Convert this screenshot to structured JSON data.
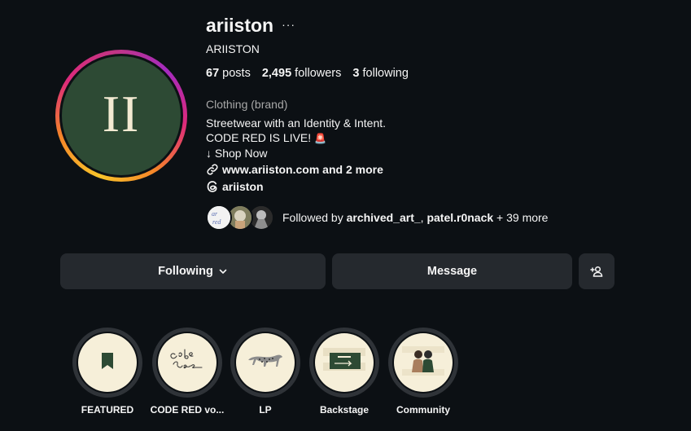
{
  "profile": {
    "username": "ariiston",
    "more_icon": "···",
    "display_name": "ARIISTON",
    "avatar_monogram": "II",
    "stats": {
      "posts_count": "67",
      "posts_label": "posts",
      "followers_count": "2,495",
      "followers_label": "followers",
      "following_count": "3",
      "following_label": "following"
    },
    "category": "Clothing (brand)",
    "bio": {
      "line1": "Streetwear with an Identity & Intent.",
      "line2": "CODE RED IS LIVE!",
      "line2_emoji": "🚨",
      "line3": "↓ Shop Now"
    },
    "link": "www.ariiston.com and 2 more",
    "threads_handle": "ariiston",
    "followed_by": {
      "prefix": "Followed by ",
      "user1": "archived_art_",
      "separator": ", ",
      "user2": "patel.r0nack",
      "suffix": " + 39 more"
    }
  },
  "actions": {
    "following_label": "Following",
    "message_label": "Message",
    "add_user_icon": "add-person-icon"
  },
  "highlights": [
    {
      "label": "FEATURED"
    },
    {
      "label": "CODE RED vo..."
    },
    {
      "label": "LP"
    },
    {
      "label": "Backstage"
    },
    {
      "label": "Community"
    }
  ],
  "colors": {
    "background": "#0c1014",
    "button": "#25292e",
    "avatar_bg": "#2d4a34",
    "highlight_bg": "#f6efd9",
    "muted_text": "#a8a8a8"
  }
}
